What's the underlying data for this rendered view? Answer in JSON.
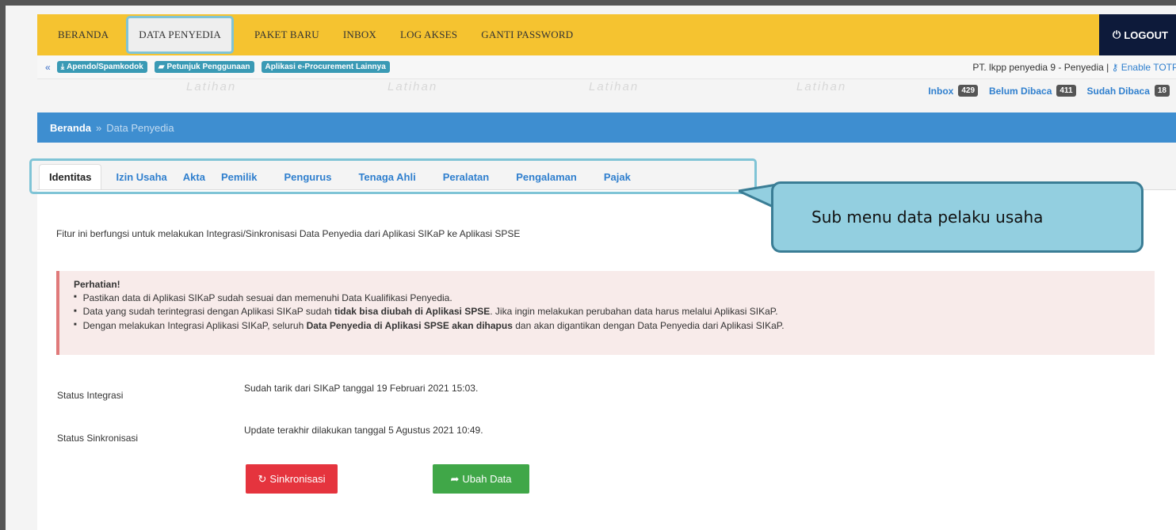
{
  "nav": {
    "items": [
      "BERANDA",
      "DATA PENYEDIA",
      "PAKET BARU",
      "INBOX",
      "LOG AKSES",
      "GANTI PASSWORD"
    ],
    "active": "DATA PENYEDIA",
    "logout": "LOGOUT"
  },
  "subbar": {
    "links": [
      "Apendo/Spamkodok",
      "Petunjuk Penggunaan",
      "Aplikasi e-Procurement Lainnya"
    ],
    "user_info": "PT. lkpp penyedia 9 - Penyedia |",
    "enable_totp": "Enable TOTP"
  },
  "inbox": {
    "inbox_label": "Inbox",
    "inbox_count": "429",
    "unread_label": "Belum Dibaca",
    "unread_count": "411",
    "read_label": "Sudah Dibaca",
    "read_count": "18"
  },
  "breadcrumb": {
    "home": "Beranda",
    "separator": "»",
    "current": "Data Penyedia"
  },
  "tabs": [
    "Identitas",
    "Izin Usaha",
    "Akta",
    "Pemilik",
    "Pengurus",
    "Tenaga Ahli",
    "Peralatan",
    "Pengalaman",
    "Pajak"
  ],
  "active_tab": "Identitas",
  "watermark": "Latihan",
  "content": {
    "intro": "Fitur ini berfungsi untuk melakukan Integrasi/Sinkronisasi Data Penyedia dari Aplikasi SIKaP ke Aplikasi SPSE",
    "alert_title": "Perhatian!",
    "alert_items": {
      "item1": "Pastikan data di Aplikasi SIKaP sudah sesuai dan memenuhi Data Kualifikasi Penyedia.",
      "item2_pre": "Data yang sudah terintegrasi dengan Aplikasi SIKaP sudah ",
      "item2_bold": "tidak bisa diubah di Aplikasi SPSE",
      "item2_post": ". Jika ingin melakukan perubahan data harus melalui Aplikasi SIKaP.",
      "item3_pre": "Dengan melakukan Integrasi Aplikasi SIKaP, seluruh ",
      "item3_bold": "Data Penyedia di Aplikasi SPSE akan dihapus",
      "item3_post": " dan akan digantikan dengan Data Penyedia dari Aplikasi SIKaP."
    },
    "status_integrasi_label": "Status Integrasi",
    "status_integrasi_value": "Sudah tarik dari SIKaP tanggal 19 Februari 2021 15:03.",
    "status_sinkronisasi_label": "Status Sinkronisasi",
    "status_sinkronisasi_value": "Update terakhir dilakukan tanggal 5 Agustus 2021 10:49.",
    "btn_sync": "Sinkronisasi",
    "btn_edit": "Ubah Data"
  },
  "callout": "Sub menu data pelaku usaha",
  "colors": {
    "nav_bg": "#f5c330",
    "breadcrumb_bg": "#3e8ed0",
    "sync_button": "#e5343e",
    "edit_button": "#40a748",
    "callout_bg": "#93cfe0"
  }
}
